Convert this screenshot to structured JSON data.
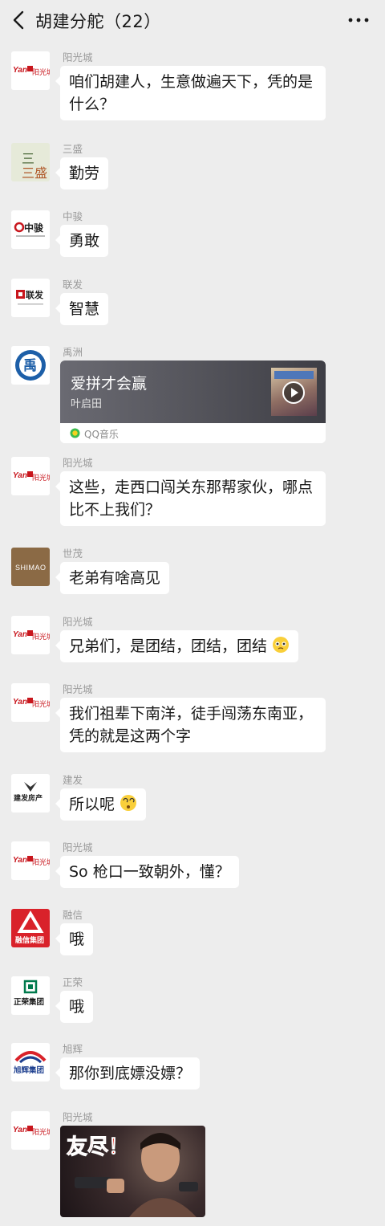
{
  "header": {
    "title": "胡建分舵（22）"
  },
  "messages": [
    {
      "sender": "阳光城",
      "text": "咱们胡建人，生意做遍天下，凭的是什么？",
      "avatar_logo_text": "阳光城"
    },
    {
      "sender": "三盛",
      "text": "勤劳",
      "avatar_logo_text": "三盛"
    },
    {
      "sender": "中骏",
      "text": "勇敢",
      "avatar_logo_text": "中骏"
    },
    {
      "sender": "联发",
      "text": "智慧",
      "avatar_logo_text": "联发"
    },
    {
      "sender": "禹洲",
      "type": "music_card",
      "avatar_logo_text": "禹"
    },
    {
      "sender": "阳光城",
      "text": "这些，走西口闯关东那帮家伙，哪点比不上我们？"
    },
    {
      "sender": "世茂",
      "text": "老弟有啥高见",
      "avatar_logo_text": "SHIMAO"
    },
    {
      "sender": "阳光城",
      "text": "兄弟们，是团结，团结，团结",
      "emoji": "pleading-face-emoji"
    },
    {
      "sender": "阳光城",
      "text": "我们祖辈下南洋，徒手闯荡东南亚，凭的就是这两个字"
    },
    {
      "sender": "建发",
      "text": "所以呢",
      "emoji": "dizzy-face-emoji",
      "avatar_logo_text": "建发房产"
    },
    {
      "sender": "阳光城",
      "text": "So 枪口一致朝外，懂？"
    },
    {
      "sender": "融信",
      "text": "哦",
      "avatar_logo_text": "融信集团"
    },
    {
      "sender": "正荣",
      "text": "哦",
      "avatar_logo_text": "正荣集团"
    },
    {
      "sender": "旭辉",
      "text": "那你到底嫖没嫖？",
      "avatar_logo_text": "旭辉集团"
    },
    {
      "sender": "阳光城",
      "type": "sticker",
      "sticker_text": "友尽！"
    }
  ],
  "music": {
    "title": "爱拼才会赢",
    "artist": "叶启田",
    "source": "QQ音乐"
  },
  "icons": {
    "back": "chevron-left-icon",
    "more": "more-dots-icon",
    "play": "play-icon",
    "qq_music": "qq-music-icon"
  },
  "colors": {
    "background": "#ededed",
    "bubble": "#ffffff",
    "sender_text": "#9a9a9a",
    "yango_red": "#c8161d",
    "rongxin_red": "#d9222a",
    "zhenro_green": "#007a4d",
    "cifi_blue": "#1d3f8f",
    "shimao_brown": "#8b6a45"
  }
}
